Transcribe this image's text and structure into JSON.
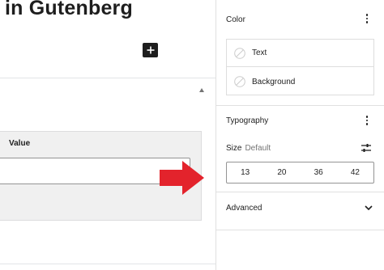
{
  "editor": {
    "post_title": "in Gutenberg",
    "table": {
      "header_value": "Value",
      "input_value": ""
    }
  },
  "sidebar": {
    "color": {
      "title": "Color",
      "items": [
        {
          "label": "Text",
          "icon": "no-color-swatch-icon"
        },
        {
          "label": "Background",
          "icon": "no-color-swatch-icon"
        }
      ]
    },
    "typography": {
      "title": "Typography",
      "size_label": "Size",
      "size_value": "Default",
      "size_options": [
        "13",
        "20",
        "36",
        "42"
      ]
    },
    "advanced": {
      "title": "Advanced"
    }
  },
  "annotation": {
    "arrow_color": "#e3232c"
  }
}
